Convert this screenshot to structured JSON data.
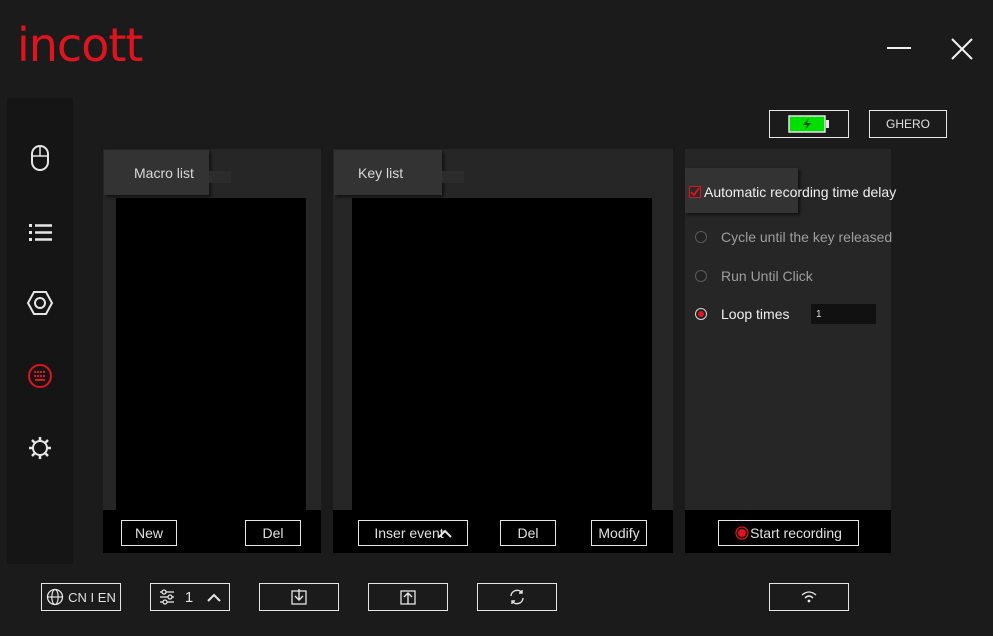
{
  "brand": {
    "logo_text": "incott",
    "color": "#e0141e"
  },
  "window": {
    "minimize_icon": "minimize-icon",
    "close_icon": "close-icon"
  },
  "sidebar": {
    "items": [
      {
        "icon": "mouse-icon",
        "active": false
      },
      {
        "icon": "list-icon",
        "active": false
      },
      {
        "icon": "hexagon-settings-icon",
        "active": false
      },
      {
        "icon": "keyboard-macro-icon",
        "active": true
      },
      {
        "icon": "gear-icon",
        "active": false
      }
    ]
  },
  "header": {
    "battery": {
      "icon": "battery-charging-icon",
      "color": "#00e000"
    },
    "device_button": "GHERO"
  },
  "macro_panel": {
    "title": "Macro list",
    "new_label": "New",
    "del_label": "Del"
  },
  "key_panel": {
    "title": "Key list",
    "insert_label": "Inser event",
    "del_label": "Del",
    "modify_label": "Modify"
  },
  "options_panel": {
    "auto_delay_label": "Automatic recording time delay",
    "auto_delay_checked": true,
    "modes": [
      {
        "label": "Cycle until the key released",
        "selected": false
      },
      {
        "label": "Run Until Click",
        "selected": false
      },
      {
        "label": "Loop times",
        "selected": true
      }
    ],
    "loop_count": "1",
    "start_label": "Start recording"
  },
  "footer": {
    "language_label": "CN I EN",
    "profile_number": "1",
    "import_icon": "import-icon",
    "export_icon": "export-icon",
    "reset_icon": "refresh-icon",
    "wireless_icon": "wifi-icon"
  }
}
